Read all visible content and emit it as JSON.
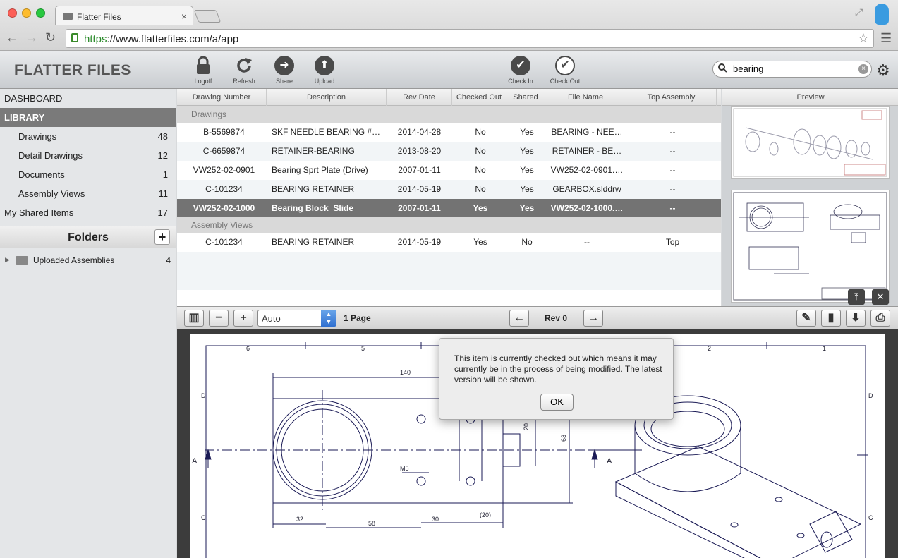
{
  "browser": {
    "tab_title": "Flatter Files",
    "url_scheme": "https",
    "url_rest": "://www.flatterfiles.com/a/app"
  },
  "header": {
    "logo": "FLATTER FILES",
    "toolbar": [
      {
        "label": "Logoff",
        "icon": "lock-icon"
      },
      {
        "label": "Refresh",
        "icon": "refresh-icon"
      },
      {
        "label": "Share",
        "icon": "share-arrow-icon"
      },
      {
        "label": "Upload",
        "icon": "upload-arrow-icon"
      },
      {
        "label": "Check In",
        "icon": "checkmark-icon"
      },
      {
        "label": "Check Out",
        "icon": "checkmark-outline-icon"
      }
    ],
    "search_value": "bearing"
  },
  "sidebar": {
    "dashboard": "DASHBOARD",
    "library": "LIBRARY",
    "items": [
      {
        "label": "Drawings",
        "count": "48"
      },
      {
        "label": "Detail Drawings",
        "count": "12"
      },
      {
        "label": "Documents",
        "count": "1"
      },
      {
        "label": "Assembly Views",
        "count": "11"
      }
    ],
    "shared": {
      "label": "My Shared Items",
      "count": "17"
    },
    "folders_title": "Folders",
    "folders_add": "+",
    "folder": {
      "label": "Uploaded Assemblies",
      "count": "4"
    }
  },
  "table": {
    "columns": [
      "Drawing Number",
      "Description",
      "Rev Date",
      "Checked Out",
      "Shared",
      "File Name",
      "Top Assembly"
    ],
    "groups": [
      "Drawings",
      "Assembly Views"
    ],
    "rows": [
      {
        "num": "B-5569874",
        "desc": "SKF NEEDLE BEARING #…",
        "date": "2014-04-28",
        "out": "No",
        "shared": "Yes",
        "file": "BEARING - NEE…",
        "top": "--"
      },
      {
        "num": "C-6659874",
        "desc": "RETAINER-BEARING",
        "date": "2013-08-20",
        "out": "No",
        "shared": "Yes",
        "file": "RETAINER - BE…",
        "top": "--"
      },
      {
        "num": "VW252-02-0901",
        "desc": "Bearing Sprt  Plate (Drive)",
        "date": "2007-01-11",
        "out": "No",
        "shared": "Yes",
        "file": "VW252-02-0901.…",
        "top": "--"
      },
      {
        "num": "C-101234",
        "desc": "BEARING RETAINER",
        "date": "2014-05-19",
        "out": "No",
        "shared": "Yes",
        "file": "GEARBOX.slddrw",
        "top": "--"
      },
      {
        "num": "VW252-02-1000",
        "desc": "Bearing Block_Slide",
        "date": "2007-01-11",
        "out": "Yes",
        "shared": "Yes",
        "file": "VW252-02-1000.…",
        "top": "--"
      },
      {
        "num": "C-101234",
        "desc": "BEARING RETAINER",
        "date": "2014-05-19",
        "out": "Yes",
        "shared": "No",
        "file": "--",
        "top": "Top"
      }
    ]
  },
  "preview": {
    "title": "Preview"
  },
  "viewer": {
    "zoom": "Auto",
    "pages": "1 Page",
    "rev": "Rev 0"
  },
  "drawing": {
    "col_marks": [
      "6",
      "5",
      "2",
      "1"
    ],
    "row_marks": [
      "D",
      "C"
    ],
    "section": "A",
    "dims": [
      "140",
      "32",
      "58",
      "30",
      "(20)",
      "M5",
      "20",
      "63"
    ]
  },
  "dialog": {
    "message": "This item is currently checked out which means it may currently be in the process of being modified.  The latest version will be shown.",
    "ok": "OK"
  }
}
